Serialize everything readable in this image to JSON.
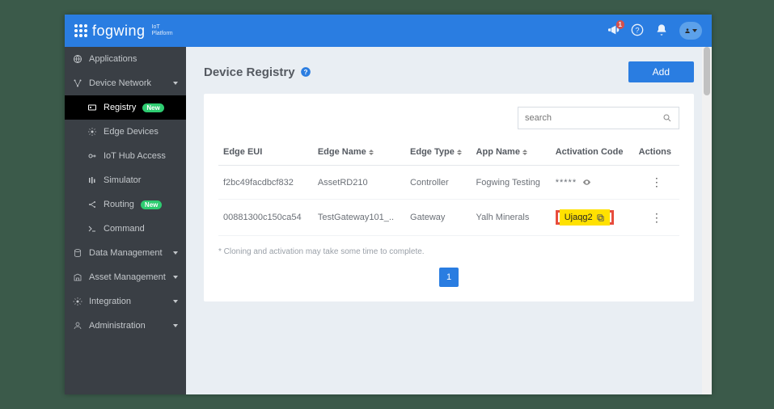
{
  "brand": {
    "name": "fogwing",
    "sub": "IoT\nPlatform"
  },
  "notifications_count": "1",
  "sidebar": {
    "applications": "Applications",
    "device_network": "Device Network",
    "registry": "Registry",
    "edge_devices": "Edge Devices",
    "iot_hub_access": "IoT Hub Access",
    "simulator": "Simulator",
    "routing": "Routing",
    "command": "Command",
    "data_management": "Data Management",
    "asset_management": "Asset Management",
    "integration": "Integration",
    "administration": "Administration",
    "new_badge": "New"
  },
  "page": {
    "title": "Device Registry",
    "add": "Add",
    "search_placeholder": "search",
    "note": "* Cloning and activation may take some time to complete.",
    "page_number": "1"
  },
  "table": {
    "headers": {
      "edge_eui": "Edge EUI",
      "edge_name": "Edge Name",
      "edge_type": "Edge Type",
      "app_name": "App Name",
      "activation_code": "Activation Code",
      "actions": "Actions"
    },
    "rows": [
      {
        "eui": "f2bc49facdbcf832",
        "name": "AssetRD210",
        "type": "Controller",
        "app": "Fogwing Testing",
        "code": "*****",
        "masked": true
      },
      {
        "eui": "00881300c150ca54",
        "name": "TestGateway101_..",
        "type": "Gateway",
        "app": "Yalh Minerals",
        "code": "Ujaqg2",
        "highlighted": true
      }
    ]
  }
}
